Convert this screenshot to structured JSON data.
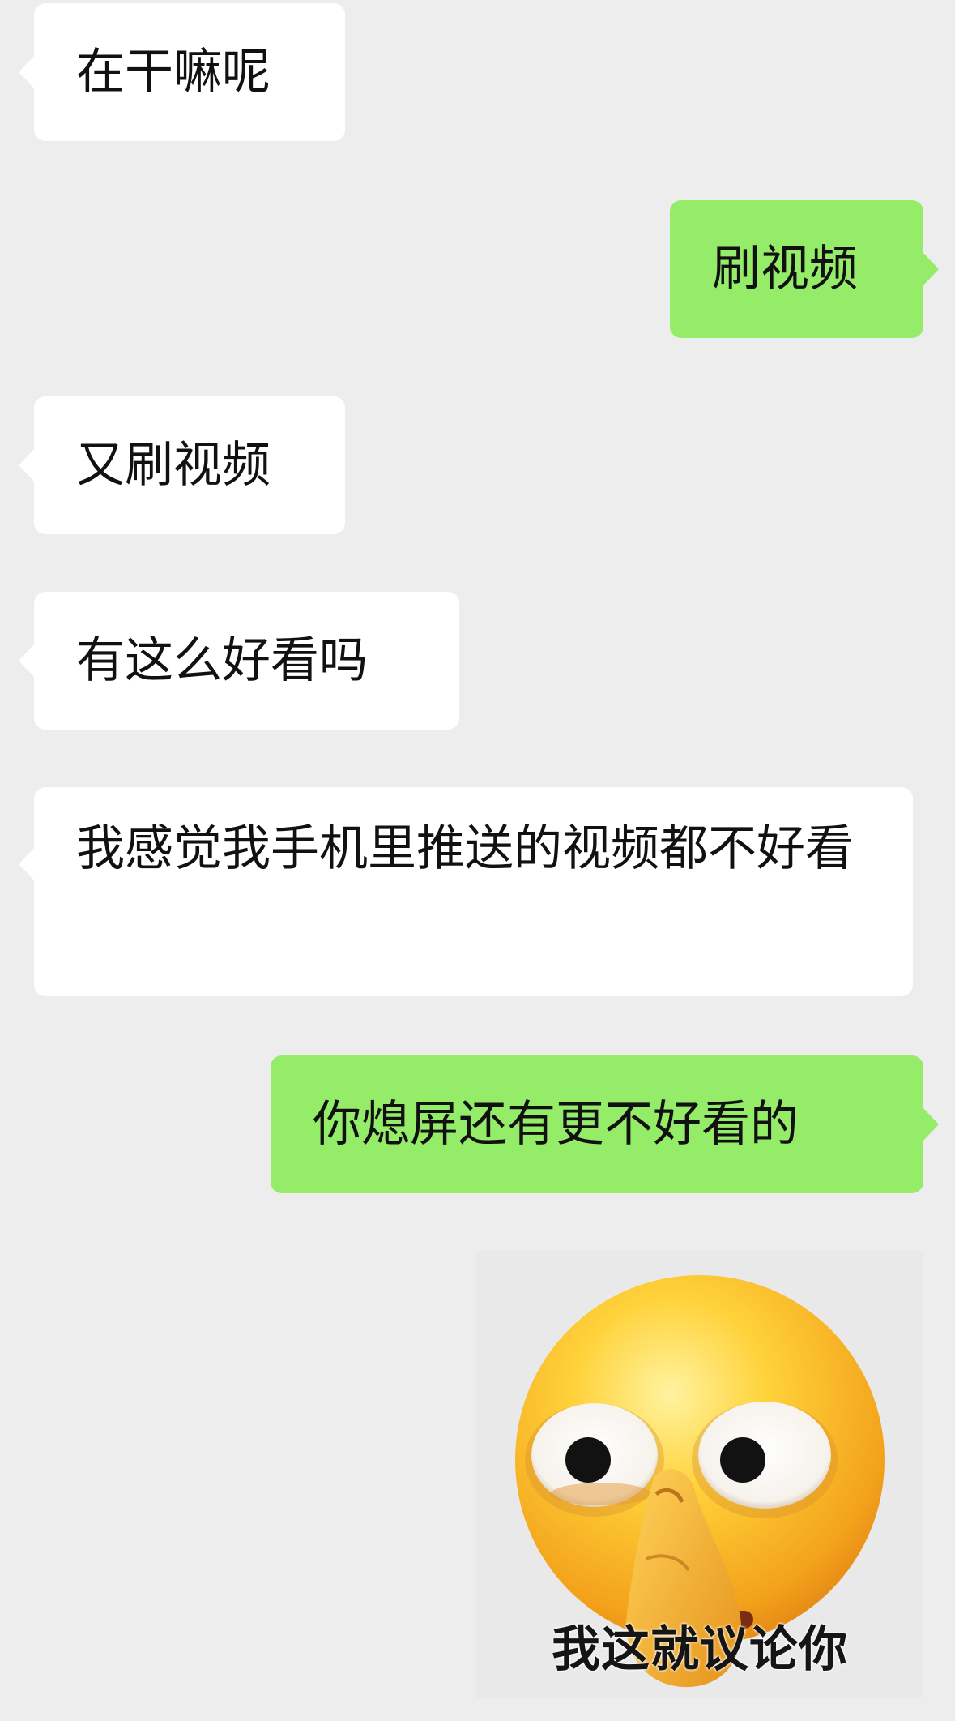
{
  "chat": {
    "messages": [
      {
        "side": "in",
        "text": "在干嘛呢"
      },
      {
        "side": "out",
        "text": "刷视频"
      },
      {
        "side": "in",
        "text": "又刷视频"
      },
      {
        "side": "in",
        "text": "有这么好看吗"
      },
      {
        "side": "in",
        "text": "我感觉我手机里推送的视频都不好看"
      },
      {
        "side": "out",
        "text": "你熄屏还有更不好看的"
      }
    ],
    "sticker": {
      "side": "out",
      "icon": "eye-roll-nose-pick-emoji",
      "caption": "我这就议论你"
    }
  },
  "colors": {
    "background": "#ededed",
    "incoming_bubble": "#ffffff",
    "outgoing_bubble": "#95ec69"
  }
}
